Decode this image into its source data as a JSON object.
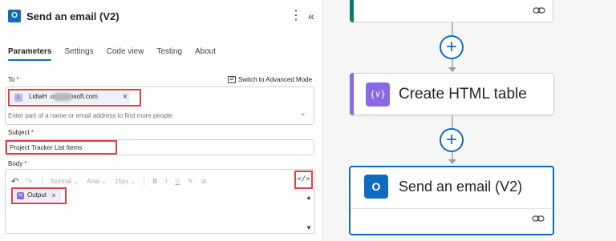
{
  "panel": {
    "title": "Send an email (V2)",
    "app_icon": "outlook-icon",
    "more_glyph": "⋮",
    "collapse_glyph": "«"
  },
  "tabs": [
    {
      "label": "Parameters",
      "active": true
    },
    {
      "label": "Settings",
      "active": false
    },
    {
      "label": "Code view",
      "active": false
    },
    {
      "label": "Testing",
      "active": false
    },
    {
      "label": "About",
      "active": false
    }
  ],
  "to": {
    "label": "To",
    "required_mark": "*",
    "advanced_mode_label": "Switch to Advanced Mode",
    "recipient_initial": "L",
    "recipient_email": "LidiaH          .onmicrosoft.com",
    "input_placeholder": "Enter part of a name or email address to find more people"
  },
  "subject": {
    "label": "Subject",
    "required_mark": "*",
    "value": "Project Tracker List Items"
  },
  "body": {
    "label": "Body",
    "required_mark": "*",
    "toolbar": {
      "font_style": "Normal",
      "font_family": "Arial",
      "font_size": "15px",
      "bold": "B",
      "italic": "I",
      "underline": "U"
    },
    "code_view_glyph": "</>",
    "token_label": "Output",
    "token_icon": "compose-icon"
  },
  "canvas": {
    "html_card": {
      "title": "Create HTML table",
      "icon": "data-operation-icon",
      "accent": "#8a68e6"
    },
    "email_card": {
      "title": "Send an email (V2)",
      "icon": "outlook-icon",
      "accent": "#0f6cbd"
    },
    "top_card_accent": "#0e7a6b",
    "plus_glyph": "+"
  }
}
